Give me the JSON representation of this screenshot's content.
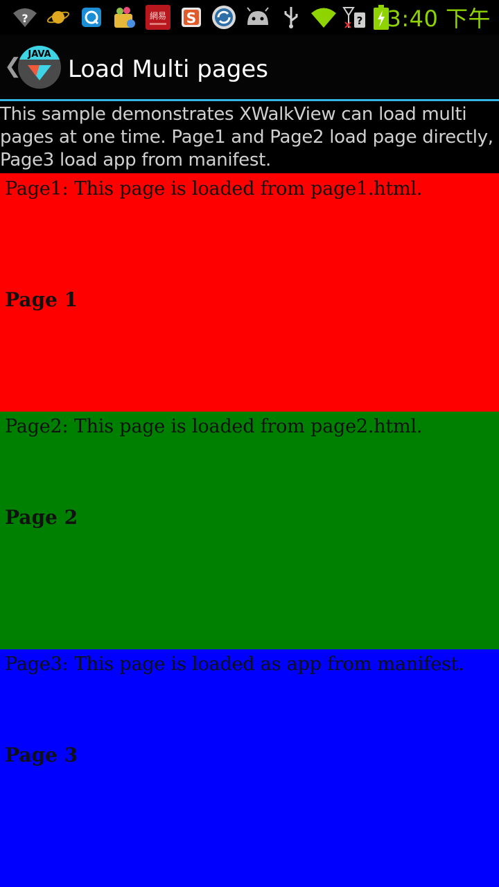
{
  "status_bar": {
    "time": "3:40 下午",
    "icons": [
      "wifi-help-icon",
      "planet-icon",
      "qq-browser-icon",
      "app-store-icon",
      "netease-icon",
      "sogou-icon",
      "sync-icon",
      "android-icon",
      "usb-icon",
      "wifi-icon",
      "signal-no-sim-icon",
      "battery-charging-icon"
    ]
  },
  "action_bar": {
    "title": "Load Multi pages",
    "logo_label": "JAVA"
  },
  "description": "This sample demonstrates XWalkView can load multi\npages at one time. Page1 and Page2 load page directly,\nPage3 load app from manifest.",
  "pages": [
    {
      "text": "Page1: This page is loaded from page1.html.",
      "heading": "Page 1",
      "color": "#ff0000"
    },
    {
      "text": "Page2: This page is loaded from page2.html.",
      "heading": "Page 2",
      "color": "#008000"
    },
    {
      "text": "Page3: This page is loaded as app from manifest.",
      "heading": "Page 3",
      "color": "#0000ff"
    }
  ],
  "colors": {
    "accent": "#33b5e5",
    "clock": "#8fd400"
  }
}
